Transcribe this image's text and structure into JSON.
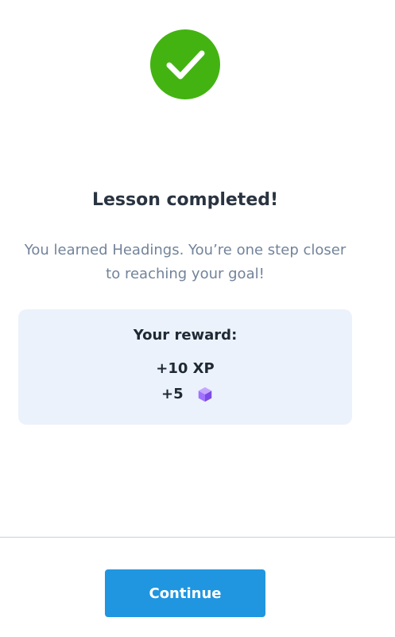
{
  "status": {
    "icon": "checkmark-icon",
    "color": "#43b312"
  },
  "title": "Lesson completed!",
  "subtitle": "You learned Headings. You’re one step closer to reaching your goal!",
  "reward": {
    "heading": "Your reward:",
    "xp": "+10 XP",
    "gems": "+5",
    "gem_icon": "gem-icon",
    "gem_color": "#9a6be0",
    "background": "#ecf2fb"
  },
  "footer": {
    "continue_label": "Continue",
    "button_color": "#2196e0"
  }
}
